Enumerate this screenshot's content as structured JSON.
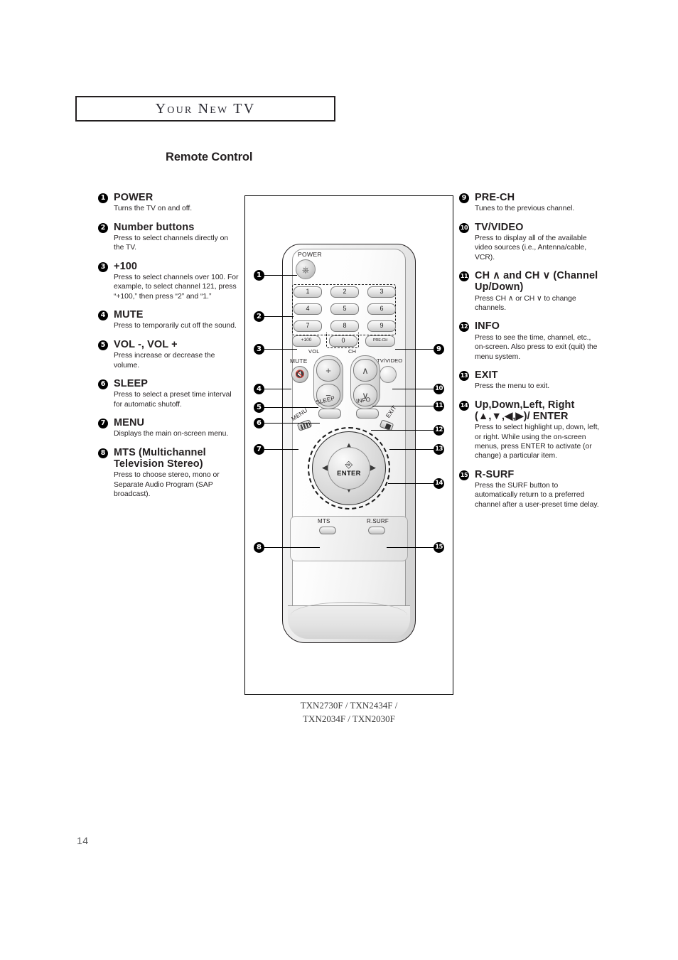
{
  "header": {
    "chapter": "Your New TV",
    "section": "Remote Control"
  },
  "page_number": "14",
  "figure": {
    "caption_line1": "TXN2730F / TXN2434F /",
    "caption_line2": "TXN2034F / TXN2030F",
    "remote": {
      "power_label": "POWER",
      "power_icon": "power-icon",
      "number_keys": [
        "1",
        "2",
        "3",
        "4",
        "5",
        "6",
        "7",
        "8",
        "9"
      ],
      "key_plus100": "+100",
      "key_zero": "0",
      "key_prech": "PRE-CH",
      "vol_label": "VOL",
      "ch_label": "CH",
      "mute_label": "MUTE",
      "mute_icon": "mute-speaker-icon",
      "vol_up_glyph": "+",
      "vol_down_glyph": "−",
      "ch_up_glyph": "∧",
      "ch_down_glyph": "∨",
      "tvvideo_label": "TV/VIDEO",
      "sleep_label": "SLEEP",
      "info_label": "INFO",
      "menu_label": "MENU",
      "exit_label": "EXIT",
      "enter_label": "ENTER",
      "enter_icon": "enter-return-icon",
      "arrow_up": "▲",
      "arrow_down": "▼",
      "arrow_left": "◀",
      "arrow_right": "▶",
      "mts_label": "MTS",
      "rsurf_label": "R.SURF"
    }
  },
  "callouts": {
    "left": [
      "1",
      "2",
      "3",
      "4",
      "5",
      "6",
      "7",
      "8"
    ],
    "right": [
      "9",
      "10",
      "11",
      "12",
      "13",
      "14",
      "15"
    ]
  },
  "left_column": [
    {
      "num": "1",
      "title": "POWER",
      "body": "Turns the TV on and off."
    },
    {
      "num": "2",
      "title": "Number buttons",
      "body": "Press to select channels directly on the TV."
    },
    {
      "num": "3",
      "title": "+100",
      "body": "Press to select channels over 100. For example, to select channel 121, press “+100,” then press “2” and “1.”"
    },
    {
      "num": "4",
      "title": "MUTE",
      "body": "Press to temporarily cut off the sound."
    },
    {
      "num": "5",
      "title": "VOL -, VOL +",
      "body": "Press increase or decrease the volume."
    },
    {
      "num": "6",
      "title": "SLEEP",
      "body": "Press to select a preset time interval for automatic shutoff."
    },
    {
      "num": "7",
      "title": "MENU",
      "body": "Displays the main on-screen menu."
    },
    {
      "num": "8",
      "title": "MTS (Multichannel Television Stereo)",
      "body": "Press to choose stereo, mono or Separate Audio Program (SAP broadcast)."
    }
  ],
  "right_column": [
    {
      "num": "9",
      "title": "PRE-CH",
      "body": "Tunes to the previous channel."
    },
    {
      "num": "10",
      "title": "TV/VIDEO",
      "body": "Press to display all of the available video sources (i.e., Antenna/cable, VCR)."
    },
    {
      "num": "11",
      "title": "CH ∧ and CH ∨ (Channel Up/Down)",
      "body": "Press CH ∧ or CH ∨ to change channels."
    },
    {
      "num": "12",
      "title": "INFO",
      "body": "Press to see the time, channel, etc., on-screen. Also press to exit (quit) the menu system."
    },
    {
      "num": "13",
      "title": "EXIT",
      "body": "Press the menu to exit."
    },
    {
      "num": "14",
      "title": "Up,Down,Left, Right (▲,▼,◀,▶)/ ENTER",
      "body": "Press to select highlight up, down, left, or right. While using the on-screen menus, press ENTER to activate (or change) a particular item."
    },
    {
      "num": "15",
      "title": "R-SURF",
      "body": "Press the SURF button to automatically return to a preferred channel after a user-preset time delay."
    }
  ]
}
